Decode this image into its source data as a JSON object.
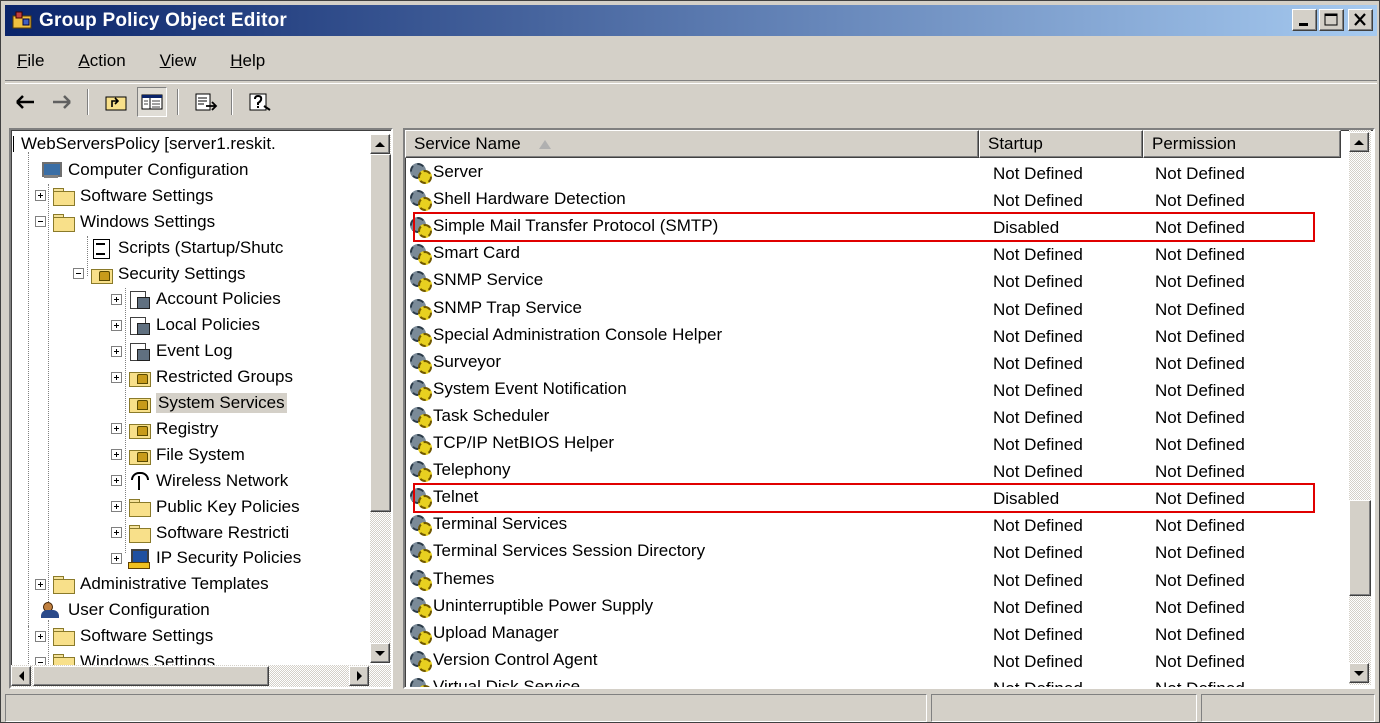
{
  "window": {
    "title": "Group Policy Object Editor",
    "title_colors": [
      "#0a246a",
      "#a6caf0"
    ],
    "buttons": [
      "minimize",
      "maximize",
      "close"
    ]
  },
  "menubar": {
    "items": [
      {
        "pre": "",
        "ul": "F",
        "post": "ile"
      },
      {
        "pre": "",
        "ul": "A",
        "post": "ction"
      },
      {
        "pre": "",
        "ul": "V",
        "post": "iew"
      },
      {
        "pre": "",
        "ul": "H",
        "post": "elp"
      }
    ]
  },
  "toolbar": {
    "icons": [
      "back-arrow-icon",
      "forward-arrow-icon",
      "up-one-level-icon",
      "show-hide-tree-icon",
      "export-list-icon",
      "help-icon"
    ]
  },
  "tree": {
    "nodes": [
      {
        "label": "WebServersPolicy [server1.reskit.",
        "icon": "policy-root-icon"
      },
      {
        "label": "Computer Configuration",
        "icon": "computer-icon"
      },
      {
        "label": "Software Settings",
        "icon": "folder-icon"
      },
      {
        "label": "Windows Settings",
        "icon": "folder-icon"
      },
      {
        "label": "Scripts (Startup/Shutc",
        "icon": "script-icon"
      },
      {
        "label": "Security Settings",
        "icon": "security-icon"
      },
      {
        "label": "Account Policies",
        "icon": "policy-icon"
      },
      {
        "label": "Local Policies",
        "icon": "policy-icon"
      },
      {
        "label": "Event Log",
        "icon": "policy-icon"
      },
      {
        "label": "Restricted Groups",
        "icon": "lock-folder-icon"
      },
      {
        "label": "System Services",
        "icon": "lock-folder-icon",
        "selected": true
      },
      {
        "label": "Registry",
        "icon": "lock-folder-icon"
      },
      {
        "label": "File System",
        "icon": "lock-folder-icon"
      },
      {
        "label": "Wireless Network",
        "icon": "antenna-icon"
      },
      {
        "label": "Public Key Policies",
        "icon": "folder-icon"
      },
      {
        "label": "Software Restricti",
        "icon": "folder-icon"
      },
      {
        "label": "IP Security Policies",
        "icon": "ip-security-icon"
      },
      {
        "label": "Administrative Templates",
        "icon": "folder-icon"
      },
      {
        "label": "User Configuration",
        "icon": "users-icon"
      },
      {
        "label": "Software Settings",
        "icon": "folder-icon"
      },
      {
        "label": "Windows Settings",
        "icon": "folder-icon"
      }
    ]
  },
  "list": {
    "columns": [
      "Service Name",
      "Startup",
      "Permission"
    ],
    "rows": [
      {
        "name": "Server",
        "startup": "Not Defined",
        "permission": "Not Defined"
      },
      {
        "name": "Shell Hardware Detection",
        "startup": "Not Defined",
        "permission": "Not Defined"
      },
      {
        "name": "Simple Mail Transfer Protocol (SMTP)",
        "startup": "Disabled",
        "permission": "Not Defined",
        "highlighted": true
      },
      {
        "name": "Smart Card",
        "startup": "Not Defined",
        "permission": "Not Defined"
      },
      {
        "name": "SNMP Service",
        "startup": "Not Defined",
        "permission": "Not Defined"
      },
      {
        "name": "SNMP Trap Service",
        "startup": "Not Defined",
        "permission": "Not Defined"
      },
      {
        "name": "Special Administration Console Helper",
        "startup": "Not Defined",
        "permission": "Not Defined"
      },
      {
        "name": "Surveyor",
        "startup": "Not Defined",
        "permission": "Not Defined"
      },
      {
        "name": "System Event Notification",
        "startup": "Not Defined",
        "permission": "Not Defined"
      },
      {
        "name": "Task Scheduler",
        "startup": "Not Defined",
        "permission": "Not Defined"
      },
      {
        "name": "TCP/IP NetBIOS Helper",
        "startup": "Not Defined",
        "permission": "Not Defined"
      },
      {
        "name": "Telephony",
        "startup": "Not Defined",
        "permission": "Not Defined"
      },
      {
        "name": "Telnet",
        "startup": "Disabled",
        "permission": "Not Defined",
        "highlighted": true
      },
      {
        "name": "Terminal Services",
        "startup": "Not Defined",
        "permission": "Not Defined"
      },
      {
        "name": "Terminal Services Session Directory",
        "startup": "Not Defined",
        "permission": "Not Defined"
      },
      {
        "name": "Themes",
        "startup": "Not Defined",
        "permission": "Not Defined"
      },
      {
        "name": "Uninterruptible Power Supply",
        "startup": "Not Defined",
        "permission": "Not Defined"
      },
      {
        "name": "Upload Manager",
        "startup": "Not Defined",
        "permission": "Not Defined"
      },
      {
        "name": "Version Control Agent",
        "startup": "Not Defined",
        "permission": "Not Defined"
      },
      {
        "name": "Virtual Disk Service",
        "startup": "Not Defined",
        "permission": "Not Defined"
      }
    ]
  },
  "highlight_color": "#e00000"
}
